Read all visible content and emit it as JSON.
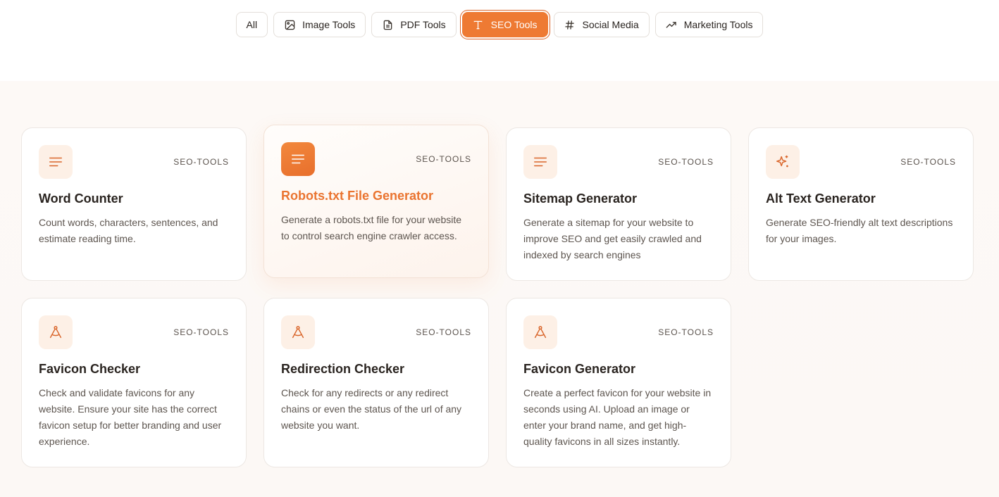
{
  "filters": [
    {
      "label": "All",
      "icon": null,
      "active": false
    },
    {
      "label": "Image Tools",
      "icon": "image-icon",
      "active": false
    },
    {
      "label": "PDF Tools",
      "icon": "document-icon",
      "active": false
    },
    {
      "label": "SEO Tools",
      "icon": "text-type-icon",
      "active": true
    },
    {
      "label": "Social Media",
      "icon": "hash-icon",
      "active": false
    },
    {
      "label": "Marketing Tools",
      "icon": "trending-up-icon",
      "active": false
    }
  ],
  "cards": [
    {
      "title": "Word Counter",
      "tag": "SEO-TOOLS",
      "icon": "text-lines-icon",
      "description": "Count words, characters, sentences, and estimate reading time."
    },
    {
      "title": "Robots.txt File Generator",
      "tag": "SEO-TOOLS",
      "icon": "text-lines-icon",
      "description": "Generate a robots.txt file for your website to control search engine crawler access."
    },
    {
      "title": "Sitemap Generator",
      "tag": "SEO-TOOLS",
      "icon": "text-lines-icon",
      "description": "Generate a sitemap for your website to improve SEO and get easily crawled and indexed by search engines"
    },
    {
      "title": "Alt Text Generator",
      "tag": "SEO-TOOLS",
      "icon": "sparkles-icon",
      "description": "Generate SEO-friendly alt text descriptions for your images."
    },
    {
      "title": "Favicon Checker",
      "tag": "SEO-TOOLS",
      "icon": "compass-drafting-icon",
      "description": "Check and validate favicons for any website. Ensure your site has the correct favicon setup for better branding and user experience."
    },
    {
      "title": "Redirection Checker",
      "tag": "SEO-TOOLS",
      "icon": "compass-drafting-icon",
      "description": "Check for any redirects or any redirect chains or even the status of the url of any website you want."
    },
    {
      "title": "Favicon Generator",
      "tag": "SEO-TOOLS",
      "icon": "compass-drafting-icon",
      "description": "Create a perfect favicon for your website in seconds using AI. Upload an image or enter your brand name, and get high-quality favicons in all sizes instantly."
    }
  ],
  "colors": {
    "accent": "#ee7a33",
    "accent_dark": "#d9652a",
    "icon_bg": "#fdf0e6"
  }
}
